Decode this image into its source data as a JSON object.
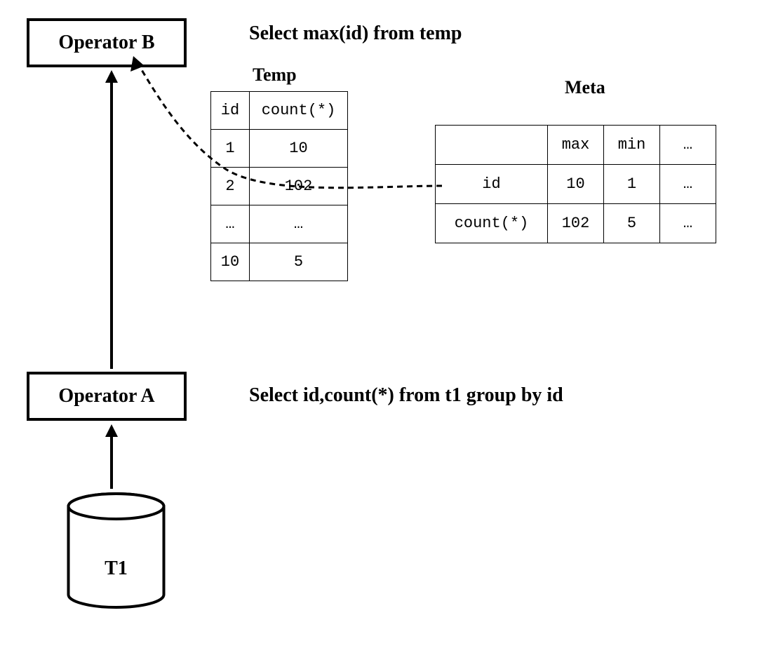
{
  "operators": {
    "b": "Operator B",
    "a": "Operator A"
  },
  "datasource": {
    "label": "T1"
  },
  "sql": {
    "top": "Select max(id) from temp",
    "bottom": "Select id,count(*) from t1 group by id"
  },
  "temp": {
    "title": "Temp",
    "headers": [
      "id",
      "count(*)"
    ],
    "rows": [
      [
        "1",
        "10"
      ],
      [
        "2",
        "102"
      ],
      [
        "…",
        "…"
      ],
      [
        "10",
        "5"
      ]
    ]
  },
  "meta": {
    "title": "Meta",
    "headers": [
      "",
      "max",
      "min",
      "…"
    ],
    "rows": [
      [
        "id",
        "10",
        "1",
        "…"
      ],
      [
        "count(*)",
        "102",
        "5",
        "…"
      ]
    ]
  }
}
